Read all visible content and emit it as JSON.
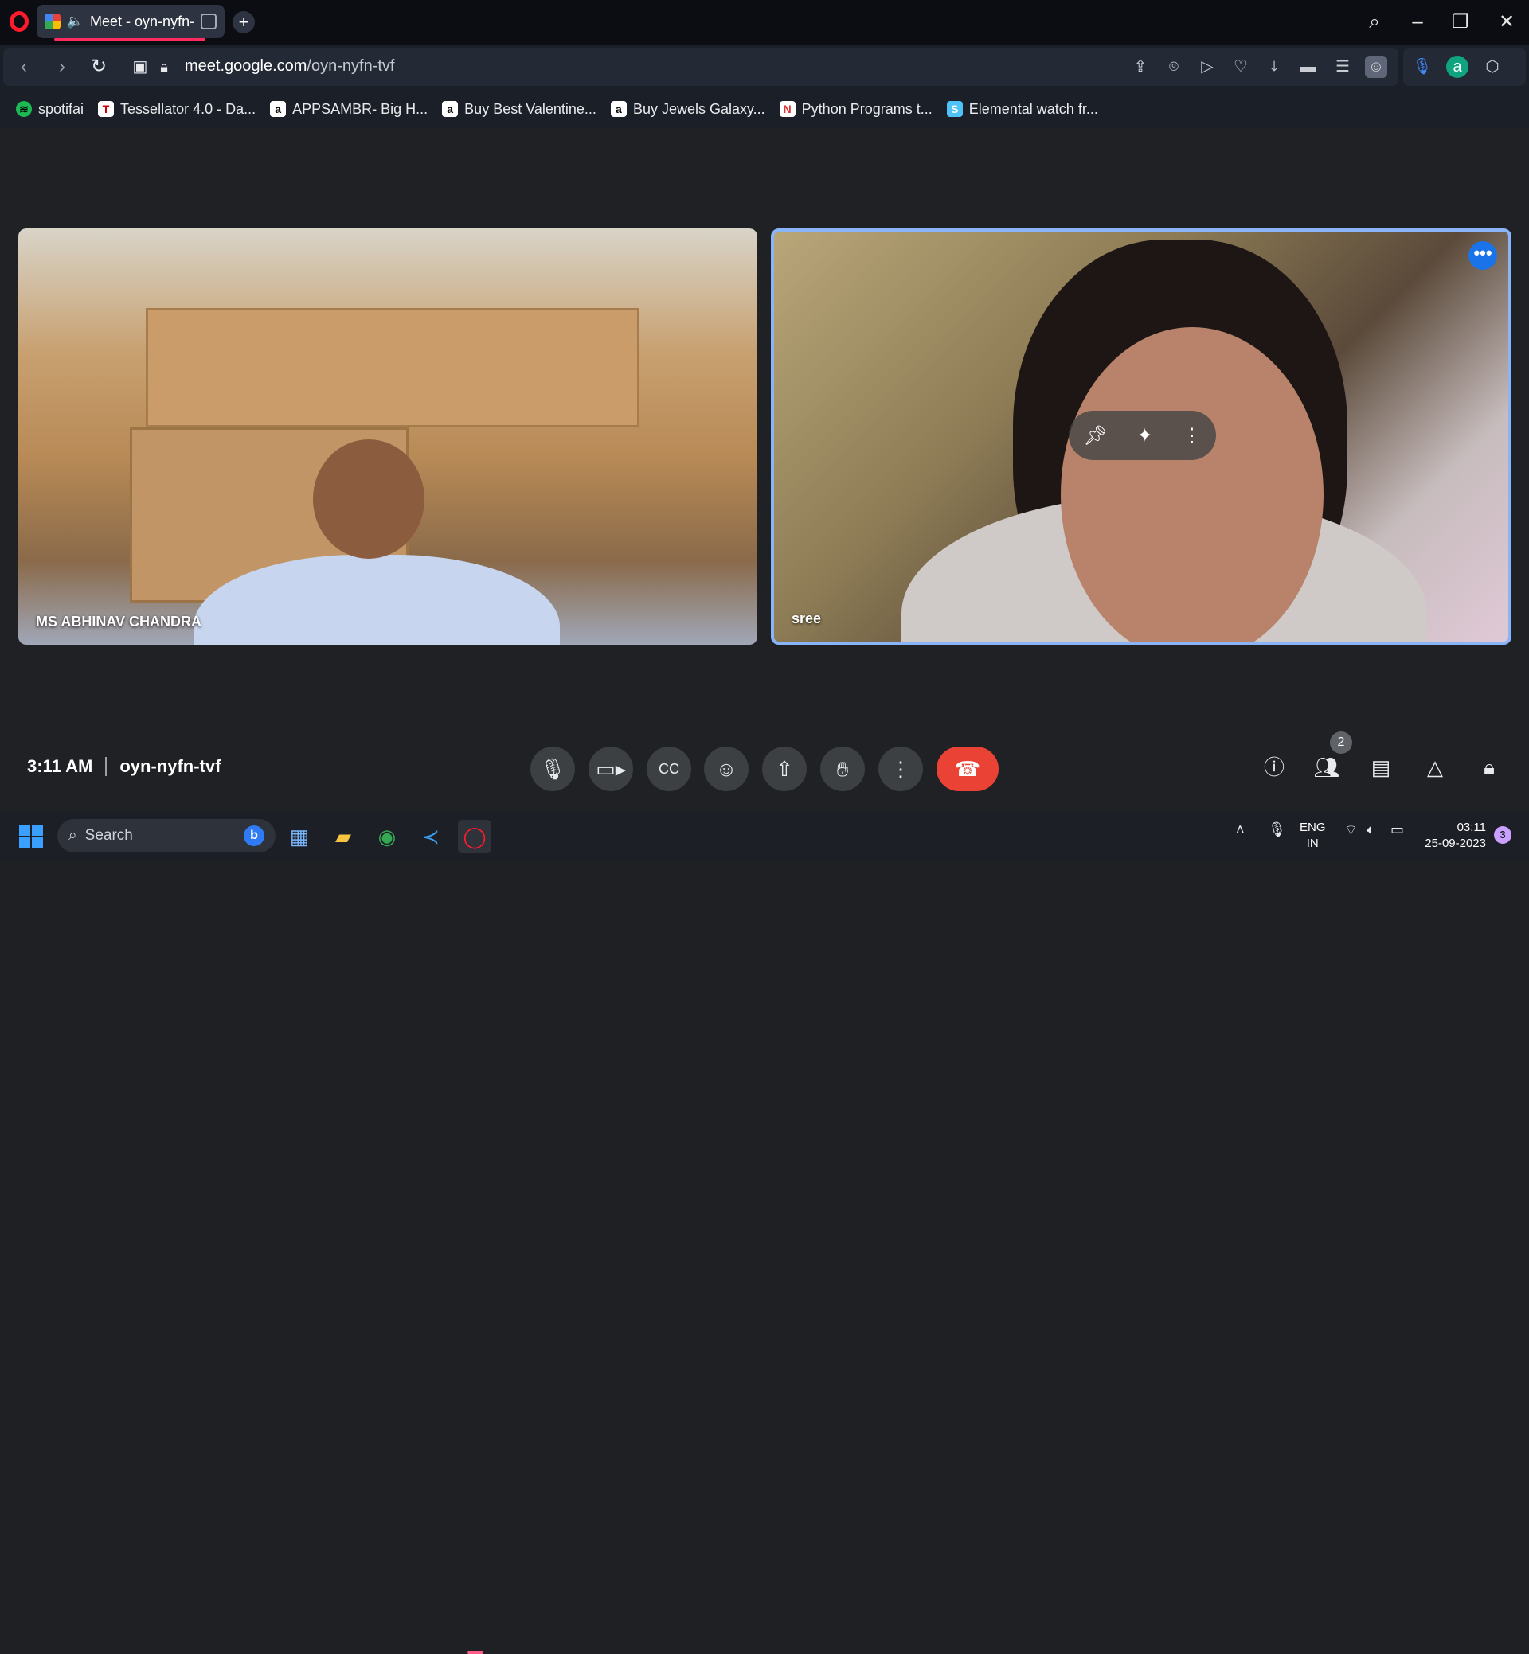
{
  "browser": {
    "tab": {
      "title": "Meet - oyn-nyfn-tvf",
      "audio_icon": "speaker-icon"
    },
    "new_tab_label": "+",
    "url_host": "meet.google.com",
    "url_path": "/oyn-nyfn-tvf",
    "window_controls": {
      "minimize": "–",
      "restore": "❐",
      "close": "✕"
    }
  },
  "bookmarks": [
    {
      "label": "spotifai",
      "icon_color": "#1db954"
    },
    {
      "label": "Tessellator 4.0 - Da...",
      "icon_color": "#ffffff"
    },
    {
      "label": "APPSAMBR- Big H...",
      "icon_color": "#ffffff"
    },
    {
      "label": "Buy Best Valentine...",
      "icon_color": "#ffffff"
    },
    {
      "label": "Buy Jewels Galaxy...",
      "icon_color": "#ffffff"
    },
    {
      "label": "Python Programs t...",
      "icon_color": "#ffffff"
    },
    {
      "label": "Elemental watch fr...",
      "icon_color": "#4fc3f7"
    }
  ],
  "meet": {
    "participants": [
      {
        "name": "MS ABHINAV CHANDRA"
      },
      {
        "name": "sree"
      }
    ],
    "time": "3:11 AM",
    "meeting_code": "oyn-nyfn-tvf",
    "people_count": "2",
    "accent": "#8ab4f8",
    "end_call_color": "#ea4335"
  },
  "taskbar": {
    "search_placeholder": "Search",
    "lang_line1": "ENG",
    "lang_line2": "IN",
    "time": "03:11",
    "date": "25-09-2023",
    "notification_count": "3"
  }
}
